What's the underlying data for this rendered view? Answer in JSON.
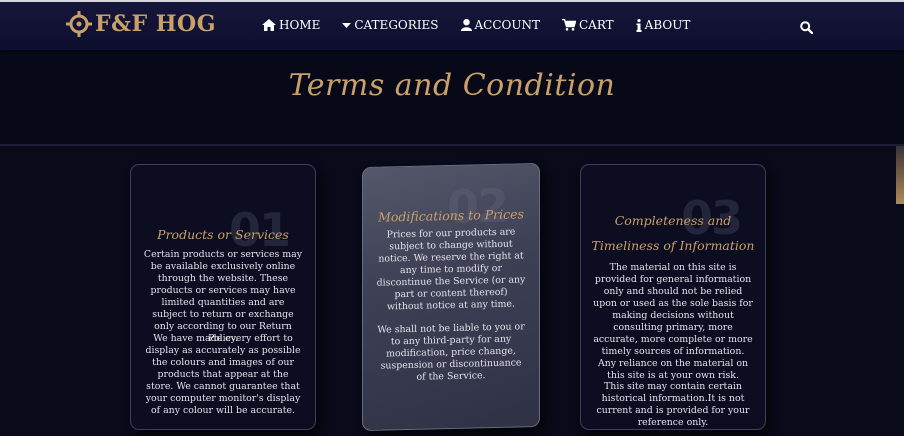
{
  "brand": {
    "name": "F&F HOG",
    "color": "#c8a06a"
  },
  "nav": {
    "items": [
      {
        "label": "HOME",
        "icon": "home-icon"
      },
      {
        "label": "CATEGORIES",
        "icon": "caret-down-icon"
      },
      {
        "label": "ACCOUNT",
        "icon": "user-icon"
      },
      {
        "label": "CART",
        "icon": "cart-icon"
      },
      {
        "label": "ABOUT",
        "icon": "info-icon"
      }
    ],
    "search_icon": "search-icon"
  },
  "page": {
    "title": "Terms and Condition"
  },
  "cards": [
    {
      "number": "01",
      "title": "Products or Services",
      "paragraphs": [
        "Certain products or services may be available exclusively online through the website. These products or services may have limited quantities and are subject to return or exchange only according to our Return Policy.",
        "We have made every effort to display as accurately as possible the colours and images of our products that appear at the store. We cannot guarantee that your computer monitor's display of any colour will be accurate."
      ]
    },
    {
      "number": "02",
      "title": "Modifications to Prices",
      "paragraphs": [
        "Prices for our products are subject to change without notice. We reserve the right at any time to modify or discontinue the Service (or any part or content thereof) without notice at any time.",
        "We shall not be liable to you or to any third-party for any modification, price change, suspension or discontinuance of the Service."
      ]
    },
    {
      "number": "03",
      "title_lines": [
        "Completeness and",
        "Timeliness of Information"
      ],
      "paragraphs": [
        "The material on this site is provided for general information only and should not be relied upon or used as the sole basis for making decisions without consulting primary, more accurate, more complete or more timely sources of information. Any reliance on the material on this site is at your own risk.",
        "This site may contain certain historical information.It is not current and is provided for your reference only."
      ]
    }
  ],
  "colors": {
    "accent": "#c9a06a",
    "nav_bg": "#12133a",
    "page_bg": "#090a1a"
  }
}
